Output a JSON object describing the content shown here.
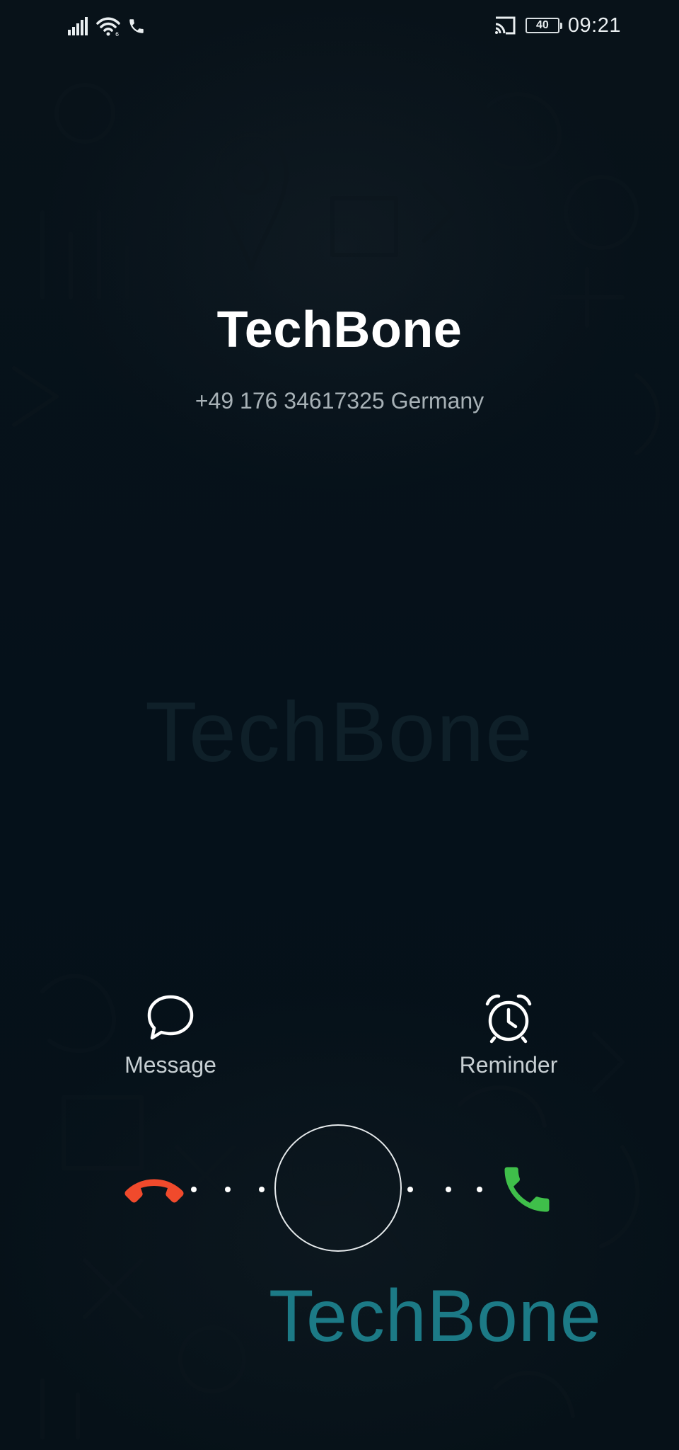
{
  "status_bar": {
    "time": "09:21",
    "battery": "40",
    "icons": [
      "signal-icon",
      "wifi-icon",
      "call-indicator-icon",
      "screen-cast-icon",
      "battery-icon"
    ]
  },
  "caller": {
    "name": "TechBone",
    "number": "+49 176 34617325 Germany"
  },
  "actions": {
    "message_label": "Message",
    "reminder_label": "Reminder"
  },
  "answer_slider": {
    "decline_icon": "phone-hangup-icon",
    "accept_icon": "phone-icon",
    "colors": {
      "decline": "#f04a2c",
      "accept": "#3fbf4a"
    }
  },
  "watermark": {
    "center_text": "TechBone",
    "brand_text": "TechBone",
    "brand_color": "#1c7a86"
  }
}
